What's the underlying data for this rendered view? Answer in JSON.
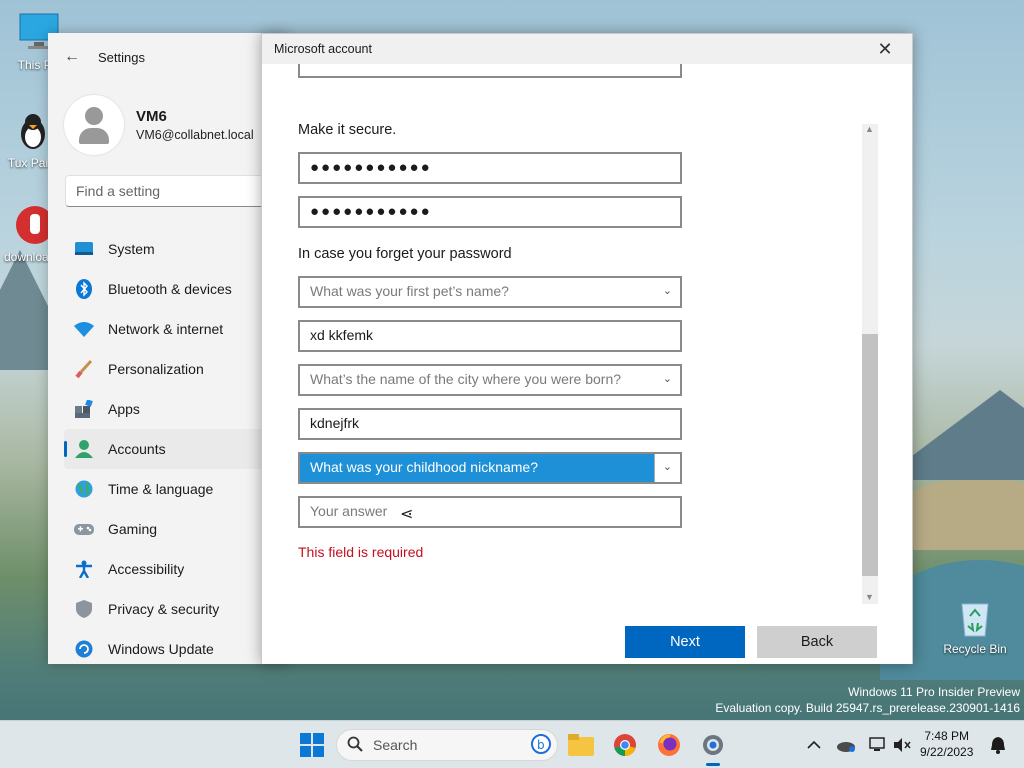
{
  "desktop": {
    "icons": [
      {
        "label": "This PC"
      },
      {
        "label": "Tux Paint"
      },
      {
        "label": "downloader"
      },
      {
        "label": "Recycle Bin"
      }
    ],
    "watermark_line1": "Windows 11 Pro Insider Preview",
    "watermark_line2": "Evaluation copy. Build 25947.rs_prerelease.230901-1416"
  },
  "settings": {
    "title": "Settings",
    "user_name": "VM6",
    "user_email": "VM6@collabnet.local",
    "search_placeholder": "Find a setting",
    "nav": [
      {
        "label": "System",
        "icon": "system-icon"
      },
      {
        "label": "Bluetooth & devices",
        "icon": "bluetooth-icon"
      },
      {
        "label": "Network & internet",
        "icon": "wifi-icon"
      },
      {
        "label": "Personalization",
        "icon": "brush-icon"
      },
      {
        "label": "Apps",
        "icon": "apps-icon"
      },
      {
        "label": "Accounts",
        "icon": "accounts-icon",
        "active": true
      },
      {
        "label": "Time & language",
        "icon": "globe-icon"
      },
      {
        "label": "Gaming",
        "icon": "gamepad-icon"
      },
      {
        "label": "Accessibility",
        "icon": "accessibility-icon"
      },
      {
        "label": "Privacy & security",
        "icon": "shield-icon"
      },
      {
        "label": "Windows Update",
        "icon": "update-icon"
      }
    ]
  },
  "dialog": {
    "title": "Microsoft account",
    "secure_label": "Make it secure.",
    "password_mask": "●●●●●●●●●●●",
    "confirm_password_mask": "●●●●●●●●●●●",
    "forget_label": "In case you forget your password",
    "q1": "What was your first pet’s name?",
    "a1": "xd kkfemk",
    "q2": "What’s the name of the city where you were born?",
    "a2": "kdnejfrk",
    "q3": "What was your childhood nickname?",
    "a3_placeholder": "Your answer",
    "error": "This field is required",
    "next_label": "Next",
    "back_label": "Back"
  },
  "taskbar": {
    "search_label": "Search",
    "time": "7:48 PM",
    "date": "9/22/2023"
  },
  "colors": {
    "accent": "#0067c0",
    "select_highlight": "#1e90d8",
    "error": "#c50f1f"
  }
}
